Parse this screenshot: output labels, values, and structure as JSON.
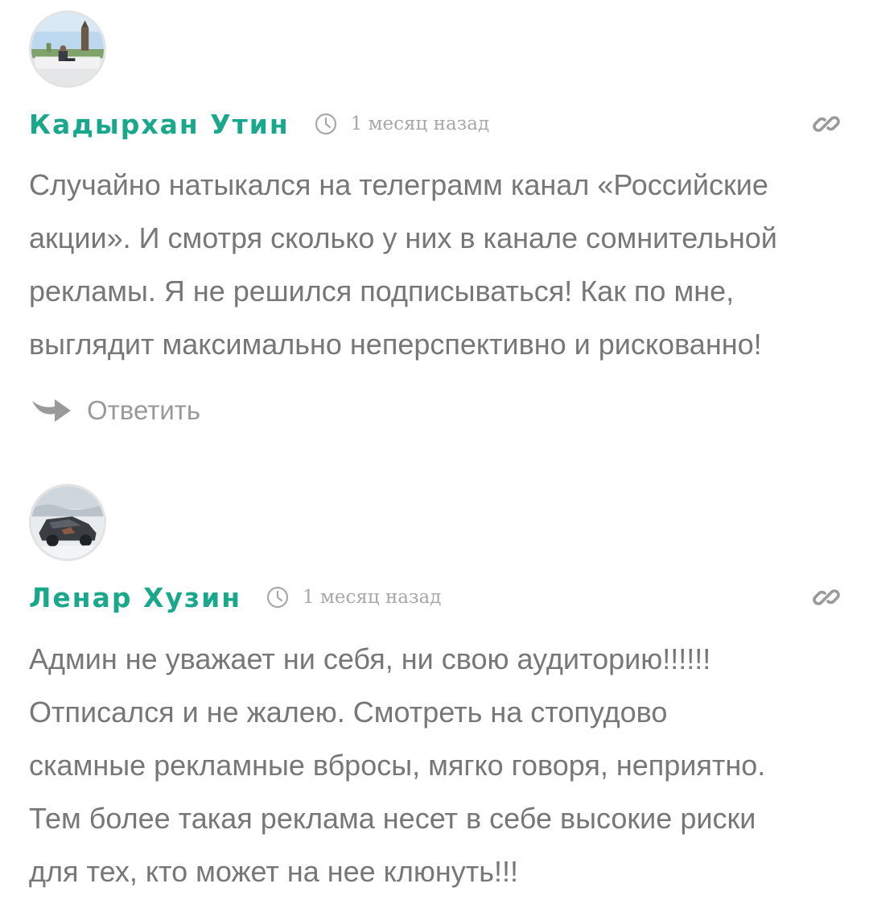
{
  "comments": [
    {
      "author": "Кадырхан Утин",
      "time": "1 месяц назад",
      "text": "Случайно натыкался на телеграмм канал «Российские\nакции». И смотря сколько у них в канале сомнительной\nрекламы. Я не решился подписываться! Как по мне,\nвыглядит максимально неперспективно и рискованно!",
      "reply_label": "Ответить",
      "avatar_icon": "avatar-photo-monument",
      "time_icon": "clock-icon",
      "link_icon": "link-icon",
      "reply_icon": "reply-arrow-icon"
    },
    {
      "author": "Ленар Хузин",
      "time": "1 месяц назад",
      "text": "Админ не уважает ни себя, ни свою аудиторию!!!!!!\nОтписался и не жалею. Смотреть на стопудово\nскамные рекламные вбросы, мягко говоря, неприятно.\nТем более такая реклама несет в себе высокие риски\nдля тех, кто может на нее клюнуть!!!",
      "avatar_icon": "avatar-photo-car",
      "time_icon": "clock-icon",
      "link_icon": "link-icon"
    }
  ],
  "colors": {
    "author": "#1aa88c",
    "text": "#777777",
    "meta": "#a8a8a8",
    "background": "#ffffff"
  }
}
